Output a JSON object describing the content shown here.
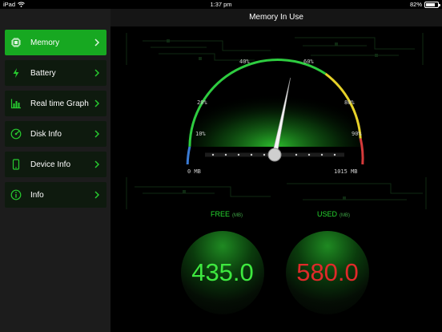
{
  "status_bar": {
    "carrier": "iPad",
    "time": "1:37 pm",
    "battery_percent": "82%",
    "battery_level": 0.82
  },
  "sidebar": {
    "items": [
      {
        "label": "Memory",
        "icon": "chip-icon",
        "active": true
      },
      {
        "label": "Battery",
        "icon": "battery-bolt-icon",
        "active": false
      },
      {
        "label": "Real time Graph",
        "icon": "bar-graph-icon",
        "active": false
      },
      {
        "label": "Disk Info",
        "icon": "disk-icon",
        "active": false
      },
      {
        "label": "Device Info",
        "icon": "device-icon",
        "active": false
      },
      {
        "label": "Info",
        "icon": "info-icon",
        "active": false
      }
    ]
  },
  "header": {
    "title": "Memory In Use"
  },
  "gauge": {
    "ticks": [
      "10%",
      "20%",
      "40%",
      "60%",
      "80%",
      "90%"
    ],
    "min_label": "0 MB",
    "max_label": "1015 MB",
    "used_mb": 580,
    "total_mb": 1015,
    "colors": {
      "low": "#3a7bd5",
      "mid": "#2ecc40",
      "high": "#e6d229",
      "critical": "#d63a3a"
    }
  },
  "free": {
    "label": "FREE",
    "unit": "(MB)",
    "value": "435.0",
    "color": "#3ee83f"
  },
  "used": {
    "label": "USED",
    "unit": "(MB)",
    "value": "580.0",
    "color": "#e02a2a"
  }
}
